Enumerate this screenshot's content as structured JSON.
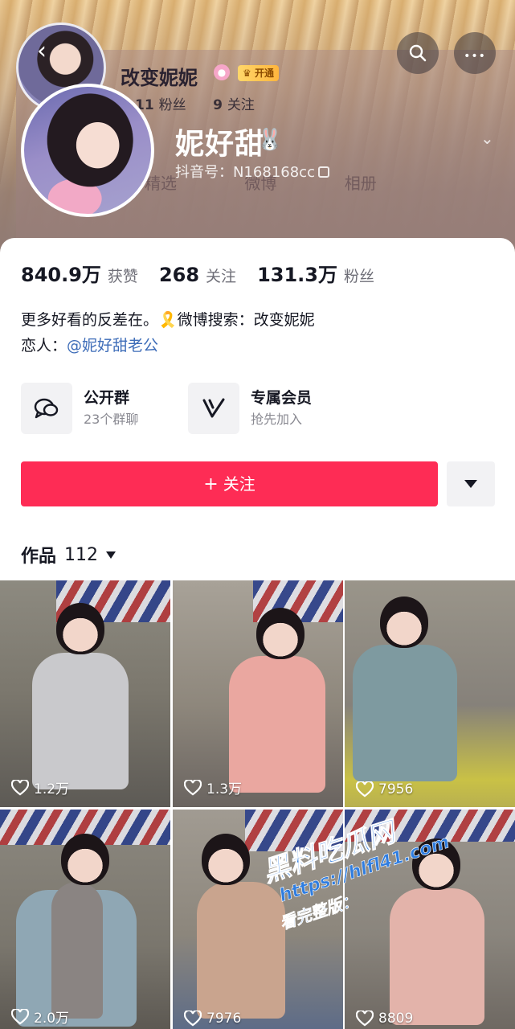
{
  "header": {
    "back_glyph": "‹",
    "search_glyph": "⌕",
    "more_glyph": "•••",
    "behind_profile": {
      "name": "改变妮妮",
      "badge": "开通",
      "followers_num": "11",
      "followers_label": "粉丝",
      "following_num": "9",
      "following_label": "关注",
      "tabs": [
        "精选",
        "微博",
        "相册"
      ]
    }
  },
  "profile": {
    "display_name": "妮好甜",
    "name_emoji": "🐰",
    "douyin_id": "抖音号：N168168cc"
  },
  "stats": [
    {
      "value": "840.9万",
      "label": "获赞"
    },
    {
      "value": "268",
      "label": "关注"
    },
    {
      "value": "131.3万",
      "label": "粉丝"
    }
  ],
  "bio": {
    "line1": "更多好看的反差在。🎗️微博搜索：改变妮妮",
    "line2_prefix": "恋人：",
    "line2_mention": "@妮好甜老公"
  },
  "features": [
    {
      "title": "公开群",
      "subtitle": "23个群聊",
      "icon": "chat-bubbles-icon"
    },
    {
      "title": "专属会员",
      "subtitle": "抢先加入",
      "icon": "v-member-icon"
    }
  ],
  "follow_button": {
    "plus": "+",
    "label": "关注"
  },
  "works": {
    "label": "作品",
    "count": "112"
  },
  "grid": [
    {
      "likes": "1.2万"
    },
    {
      "likes": "1.3万"
    },
    {
      "likes": "7956"
    },
    {
      "likes": "2.0万"
    },
    {
      "likes": "7976"
    },
    {
      "likes": "8809"
    }
  ],
  "watermark": {
    "title": "黑料吃瓜网",
    "url": "https://hlfl41.com",
    "sub": "看完整版："
  },
  "colors": {
    "accent": "#fe2c55",
    "mention": "#3d6cb8",
    "watermark": "#2f7de0"
  }
}
